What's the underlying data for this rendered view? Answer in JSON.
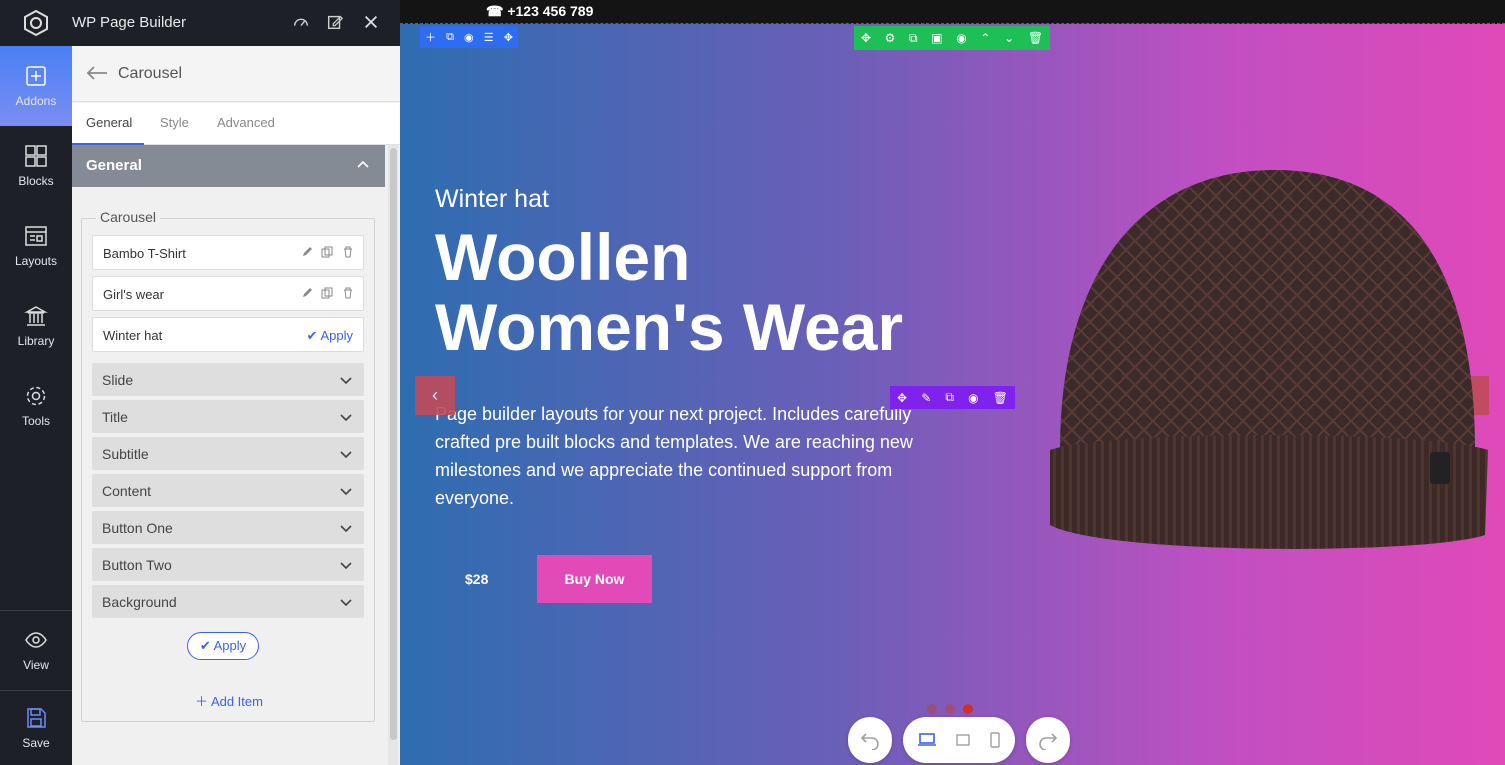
{
  "app": {
    "title": "WP Page Builder"
  },
  "rail": {
    "items": [
      {
        "label": "Addons",
        "icon": "plus-square-icon"
      },
      {
        "label": "Blocks",
        "icon": "blocks-icon"
      },
      {
        "label": "Layouts",
        "icon": "layouts-icon"
      },
      {
        "label": "Library",
        "icon": "library-icon"
      },
      {
        "label": "Tools",
        "icon": "gear-icon"
      },
      {
        "label": "View",
        "icon": "eye-icon"
      },
      {
        "label": "Save",
        "icon": "save-icon"
      }
    ]
  },
  "panel": {
    "addon_name": "Carousel",
    "tabs": [
      "General",
      "Style",
      "Advanced"
    ],
    "section_label": "General",
    "fieldset_legend": "Carousel",
    "items": [
      {
        "label": "Bambo T-Shirt"
      },
      {
        "label": "Girl's wear"
      },
      {
        "label": "Winter hat",
        "action": "Apply"
      }
    ],
    "accordions": [
      "Slide",
      "Title",
      "Subtitle",
      "Content",
      "Button One",
      "Button Two",
      "Background"
    ],
    "apply_label": "Apply",
    "add_item_label": "Add Item"
  },
  "canvas": {
    "phone": "+123 456 789",
    "slide": {
      "subtitle": "Winter hat",
      "title_line1": "Woollen",
      "title_line2": "Women's Wear",
      "content": "Page builder layouts for your next project. Includes carefully crafted pre built blocks and templates. We are reaching new milestones and we appreciate the continued support from everyone.",
      "price": "$28",
      "button": "Buy Now"
    },
    "dots_active": 3,
    "dots_total": 3
  },
  "colors": {
    "rail_bg": "#1d2027",
    "accent": "#3b63e6",
    "green_toolbar": "#1fbf57",
    "purple_toolbar": "#7f22ee",
    "buy_button": "#e24ab8"
  }
}
